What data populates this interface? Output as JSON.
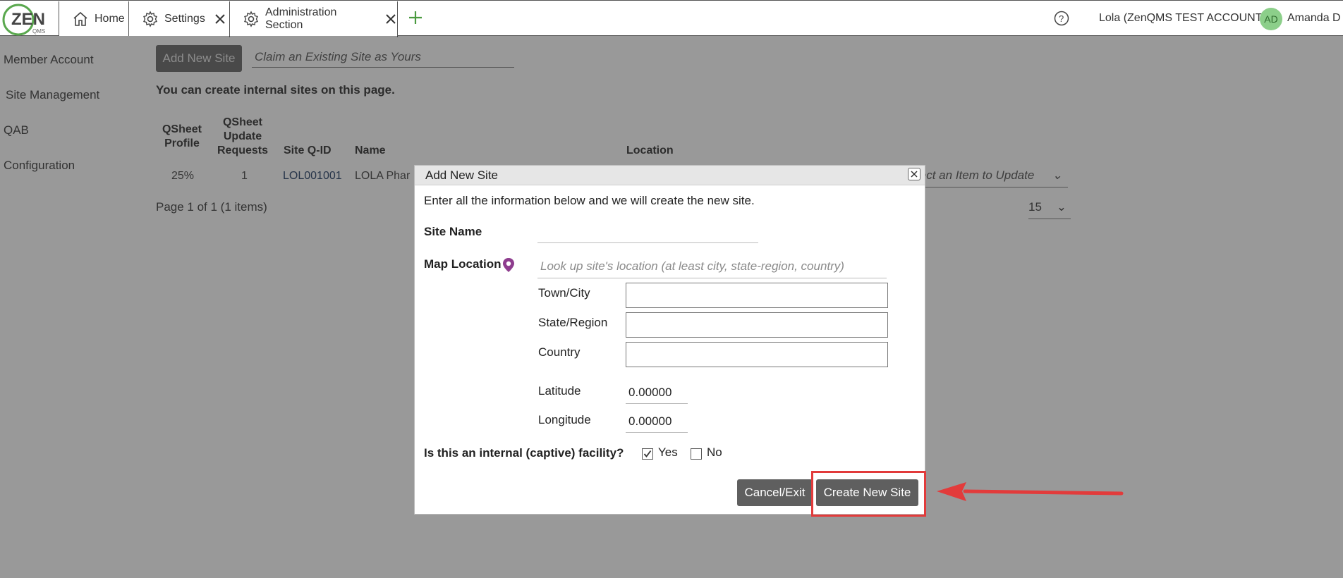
{
  "logo": {
    "text": "ZEN",
    "subtext": "QMS"
  },
  "tabs": [
    {
      "label": "Home",
      "icon": "home-icon"
    },
    {
      "label": "Settings",
      "icon": "gear-icon"
    },
    {
      "label": "Administration Section",
      "icon": "gear-icon"
    }
  ],
  "header": {
    "account": "Lola (ZenQMS TEST ACCOUNT)",
    "avatar_initials": "AD",
    "user_name": "Amanda D"
  },
  "sidebar": {
    "items": [
      {
        "label": "Member Account"
      },
      {
        "label": "Site Management"
      },
      {
        "label": "QAB"
      },
      {
        "label": "Configuration"
      }
    ]
  },
  "page": {
    "add_site_button": "Add New Site",
    "claim_placeholder": "Claim an Existing Site as Yours",
    "intro": "You can create internal sites on this page.",
    "columns": [
      "QSheet Profile",
      "QSheet Update Requests",
      "Site Q-ID",
      "Name",
      "Location"
    ],
    "row": {
      "profile": "25%",
      "requests": "1",
      "qid": "LOL001001",
      "name": "LOLA Phar",
      "update_placeholder": "lect an Item to Update"
    },
    "pager": "Page 1 of 1 (1 items)",
    "page_size": "15"
  },
  "modal": {
    "title": "Add New Site",
    "instructions": "Enter all the information below and we will create the new site.",
    "site_name_label": "Site Name",
    "site_name_value": "",
    "map_location_label": "Map Location",
    "map_location_placeholder": "Look up site's location (at least city, state-region, country)",
    "town_label": "Town/City",
    "state_label": "State/Region",
    "country_label": "Country",
    "latitude_label": "Latitude",
    "latitude_value": "0.00000",
    "longitude_label": "Longitude",
    "longitude_value": "0.00000",
    "captive_question": "Is this an internal (captive) facility?",
    "yes_label": "Yes",
    "no_label": "No",
    "yes_checked": true,
    "no_checked": false,
    "cancel_button": "Cancel/Exit",
    "create_button": "Create New Site"
  },
  "colors": {
    "accent_green": "#4a9a3f",
    "button_gray": "#5f5f5f",
    "highlight_red": "#e23b3b",
    "pin_purple": "#8e3d8e"
  }
}
